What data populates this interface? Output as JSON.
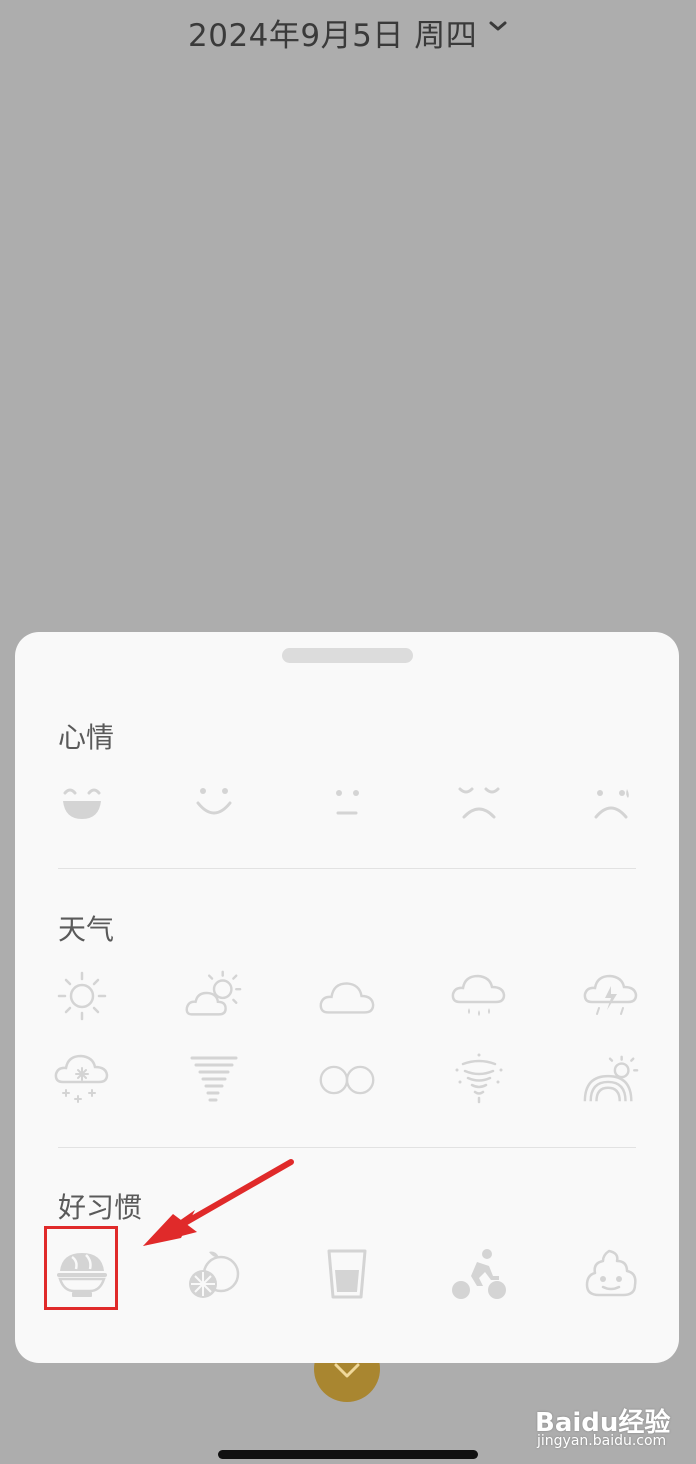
{
  "header": {
    "date_title": "2024年9月5日 周四"
  },
  "sheet": {
    "sections": [
      {
        "label": "心情",
        "icons": [
          "laughing-face-icon",
          "smiling-face-icon",
          "neutral-face-icon",
          "annoyed-face-icon",
          "sad-face-icon"
        ]
      },
      {
        "label": "天气",
        "icons": [
          "sun-icon",
          "partly-cloudy-icon",
          "cloud-icon",
          "rain-cloud-icon",
          "thunderstorm-icon",
          "snow-cloud-icon",
          "haze-icon",
          "fog-icon",
          "tornado-icon",
          "rainbow-icon"
        ]
      },
      {
        "label": "好习惯",
        "icons": [
          "rice-bowl-icon",
          "fruit-icon",
          "water-glass-icon",
          "cycling-icon",
          "poop-icon"
        ]
      }
    ]
  },
  "annotation": {
    "highlight_color": "#e02a2a"
  },
  "watermark": {
    "brand": "Baidu经验",
    "url": "jingyan.baidu.com"
  }
}
